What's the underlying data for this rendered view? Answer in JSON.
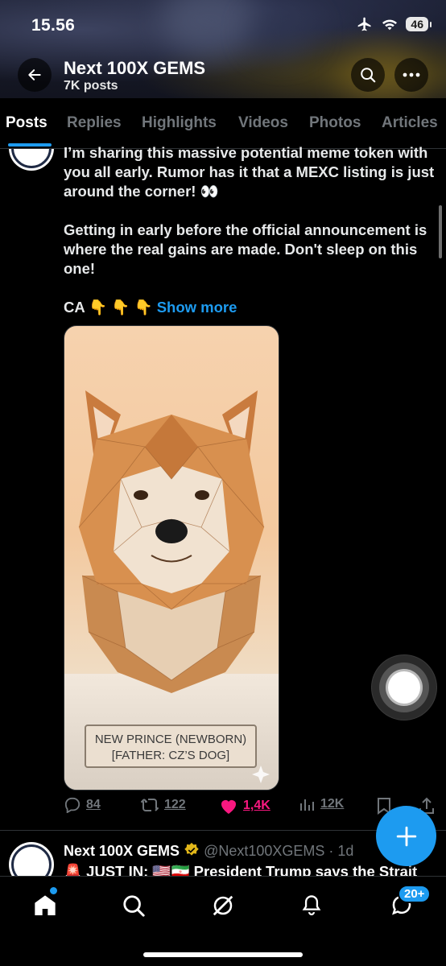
{
  "status_bar": {
    "time": "15.56",
    "battery": "46"
  },
  "header": {
    "title": "Next 100X GEMS",
    "subtitle": "7K posts"
  },
  "tabs": [
    {
      "label": "Posts",
      "active": true
    },
    {
      "label": "Replies"
    },
    {
      "label": "Highlights"
    },
    {
      "label": "Videos"
    },
    {
      "label": "Photos"
    },
    {
      "label": "Articles"
    }
  ],
  "post1": {
    "para1": "I’m sharing this massive potential meme token with you all early. Rumor has it that a MEXC listing is just around the corner! 👀",
    "para2": "Getting in early before the official announcement is where the real gains are made. Don't sleep on this one!",
    "ca_line": "CA 👇 👇 👇",
    "show_more": "Show more",
    "image": {
      "sign_line1": "NEW PRINCE (NEWBORN)",
      "sign_line2": "[FATHER: CZ’S DOG]"
    },
    "actions": {
      "replies": "84",
      "reposts": "122",
      "likes": "1,4K",
      "views": "12K"
    }
  },
  "post2": {
    "name": "Next 100X GEMS",
    "handle": "@Next100XGEMS · 1d",
    "text": "🚨 JUST IN: 🇺🇸🇮🇷 President Trump says the Strait"
  },
  "avatar_text": "Next 100X GEMS",
  "bottom_nav": {
    "messages_badge": "20+"
  },
  "colors": {
    "accent": "#1d9bf0",
    "like": "#f91880",
    "muted": "#71767b"
  }
}
